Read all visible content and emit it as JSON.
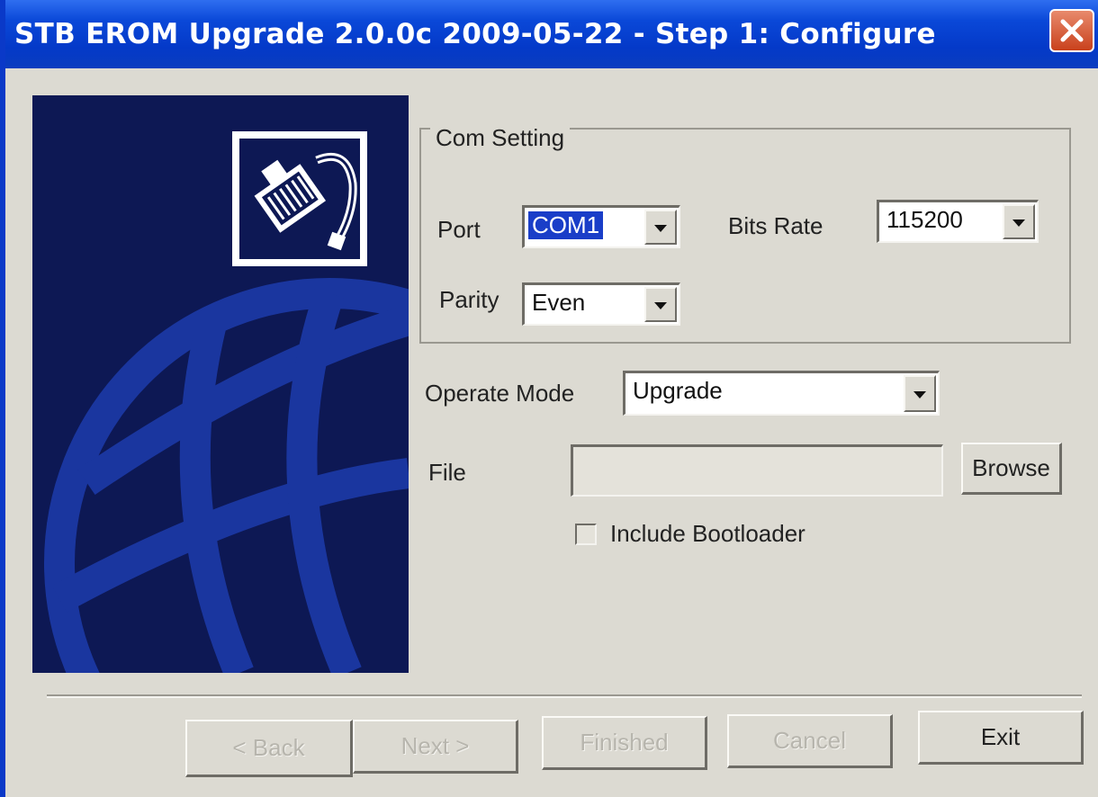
{
  "window": {
    "title": "STB EROM Upgrade 2.0.0c 2009-05-22 - Step 1: Configure",
    "close_icon": "close-icon"
  },
  "art": {
    "icon": "network-cable-icon"
  },
  "com_setting": {
    "group_title": "Com Setting",
    "port_label": "Port",
    "port_value": "COM1",
    "bits_rate_label": "Bits Rate",
    "bits_rate_value": "115200",
    "parity_label": "Parity",
    "parity_value": "Even"
  },
  "operate_mode": {
    "label": "Operate Mode",
    "value": "Upgrade"
  },
  "file": {
    "label": "File",
    "value": "",
    "browse_label": "Browse"
  },
  "include_bootloader": {
    "label": "Include Bootloader",
    "checked": false
  },
  "footer": {
    "back_label": "< Back",
    "next_label": "Next >",
    "finished_label": "Finished",
    "cancel_label": "Cancel",
    "exit_label": "Exit"
  }
}
